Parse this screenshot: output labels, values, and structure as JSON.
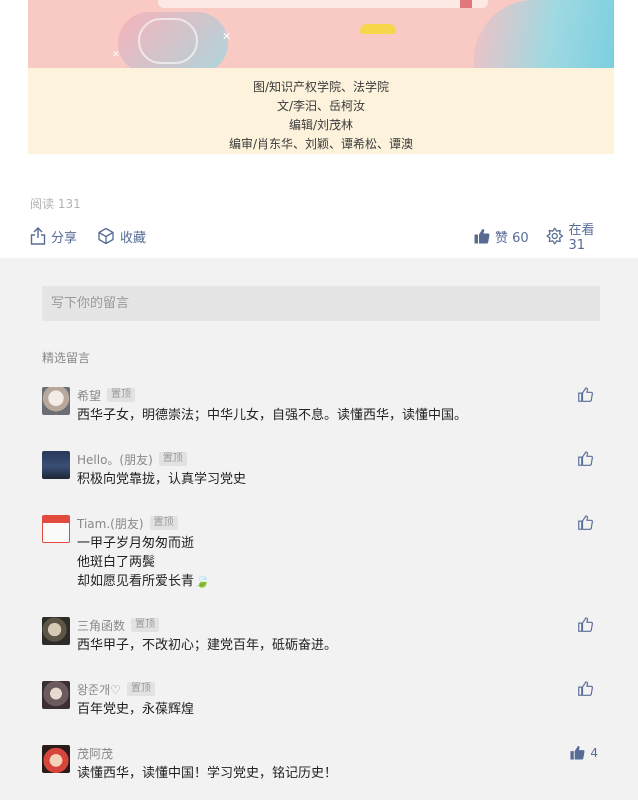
{
  "article": {
    "credits": [
      "图/知识产权学院、法学院",
      "文/李汨、岳柯汝",
      "编辑/刘茂林",
      "编审/肖东华、刘颖、谭希松、谭澳"
    ],
    "read_label": "阅读 131",
    "share_label": "分享",
    "favorite_label": "收藏",
    "like_label": "赞 60",
    "wow_label": "在看 31"
  },
  "comments": {
    "input_placeholder": "写下你的留言",
    "section_title": "精选留言",
    "items": [
      {
        "name": "希望",
        "badge": "置顶",
        "lines": [
          "西华子女，明德崇法；中华儿女，自强不息。读懂西华，读懂中国。"
        ],
        "likes": ""
      },
      {
        "name": "Hello。(朋友)",
        "badge": "置顶",
        "lines": [
          "积极向党靠拢，认真学习党史"
        ],
        "likes": ""
      },
      {
        "name": "Tiam.(朋友)",
        "badge": "置顶",
        "lines": [
          "一甲子岁月匆匆而逝",
          "他斑白了两鬓",
          "却如愿见看所爱长青🍃"
        ],
        "likes": ""
      },
      {
        "name": "三角函数",
        "badge": "置顶",
        "lines": [
          "西华甲子，不改初心；建党百年，砥砺奋进。"
        ],
        "likes": ""
      },
      {
        "name": "왕준개♡",
        "badge": "置顶",
        "lines": [
          "百年党史，永葆辉煌"
        ],
        "likes": ""
      },
      {
        "name": "茂阿茂",
        "badge": "",
        "lines": [
          "读懂西华，读懂中国！学习党史，铭记历史！"
        ],
        "likes": "4"
      }
    ]
  },
  "colors": {
    "link": "#576b95",
    "panel": "#f2f2f2",
    "credits_bg": "#fdf3dc",
    "banner_bg": "#f9c9c4"
  }
}
